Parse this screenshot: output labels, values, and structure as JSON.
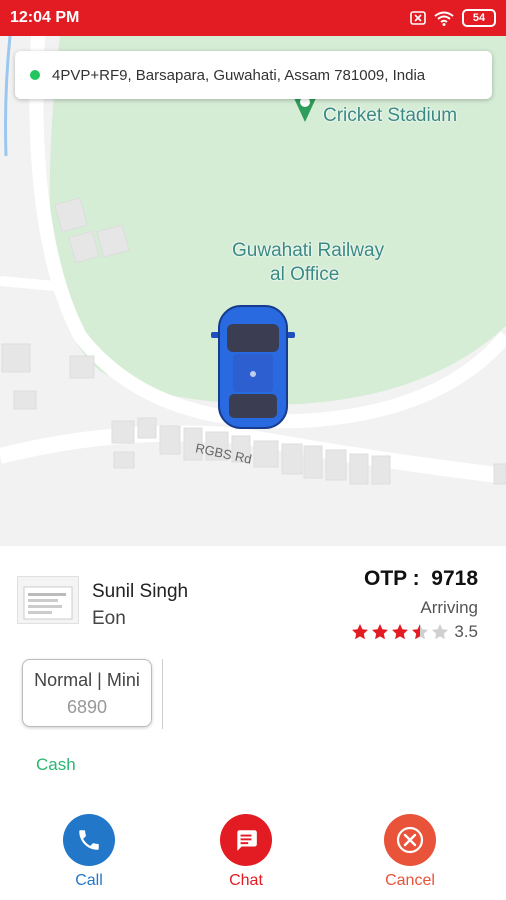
{
  "status_bar": {
    "time": "12:04 PM",
    "battery": "54",
    "icons": [
      "sim-off-icon",
      "wifi-icon",
      "battery-icon"
    ],
    "color": "#e31b23"
  },
  "map": {
    "address": "4PVP+RF9, Barsapara, Guwahati, Assam 781009, India",
    "labels": {
      "stadium": "Cricket Stadium",
      "office_line1": "Guwahati Railway",
      "office_line2": "al Office",
      "road": "RGBS Rd"
    },
    "colors": {
      "park": "#d5ecd5",
      "background": "#f2f2f2",
      "accent_pin": "#2e9d5a"
    }
  },
  "driver": {
    "name": "Sunil Singh",
    "vehicle": "Eon",
    "otp_label": "OTP :",
    "otp_value": "9718",
    "status": "Arriving",
    "rating": 3.5,
    "rating_text": "3.5",
    "stars_max": 5
  },
  "service": {
    "name": "Normal | Mini",
    "price": "6890"
  },
  "payment": {
    "method": "Cash",
    "color": "#2bb673"
  },
  "actions": [
    {
      "id": "call",
      "label": "Call",
      "icon": "phone-icon",
      "color": "#2277c9"
    },
    {
      "id": "chat",
      "label": "Chat",
      "icon": "chat-icon",
      "color": "#e31b23"
    },
    {
      "id": "cancel",
      "label": "Cancel",
      "icon": "cancel-icon",
      "color": "#e8533a"
    }
  ]
}
